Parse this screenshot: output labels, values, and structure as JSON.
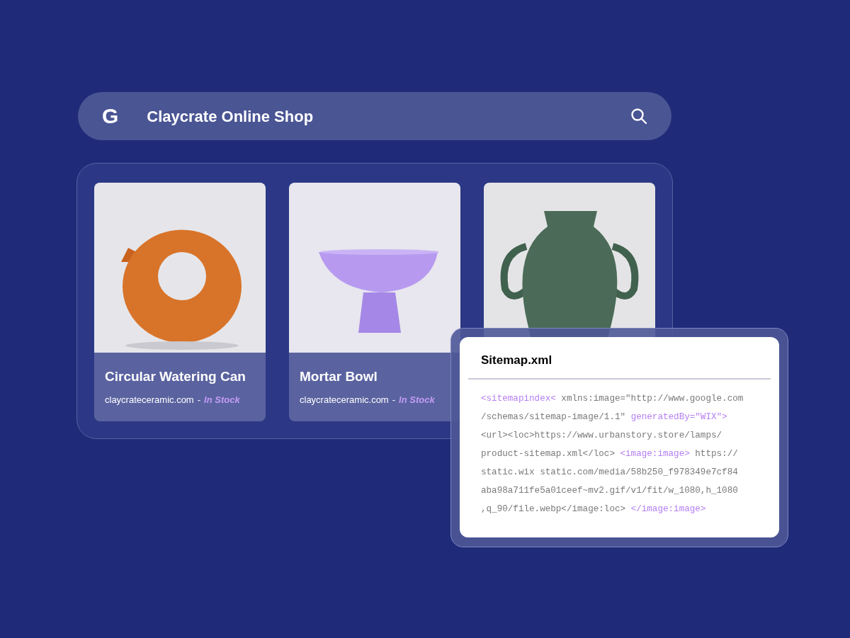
{
  "search_bar": {
    "logo": "G",
    "query": "Claycrate Online Shop"
  },
  "products": [
    {
      "kind": "listing",
      "photo": {
        "kind": "vase"
      },
      "name": "Circular Watering Can",
      "domain": "claycrateceramic.com",
      "separator": "-",
      "stock": "In Stock"
    },
    {
      "kind": "listing",
      "photo": {
        "kind": "bowl"
      },
      "name": "Mortar Bowl",
      "domain": "claycrateceramic.com",
      "separator": "-",
      "stock": "In Stock"
    },
    {
      "kind": "photo_only",
      "photo": {
        "kind": "urn"
      }
    }
  ],
  "sitemap": {
    "title": "Sitemap.xml",
    "lines": [
      [
        {
          "kind": "tag",
          "text": "<sitemapindex<"
        },
        {
          "kind": "text",
          "text": " xmlns:image=\"http://www.google.com"
        }
      ],
      [
        {
          "kind": "text",
          "text": "/schemas/sitemap-image/1.1\" "
        },
        {
          "kind": "tag",
          "text": "generatedBy=\"WIX\">"
        }
      ],
      [
        {
          "kind": "text",
          "text": "<url><loc>https://www.urbanstory.store/lamps/"
        }
      ],
      [
        {
          "kind": "text",
          "text": "product-sitemap.xml</loc> "
        },
        {
          "kind": "tag",
          "text": "<image:image>"
        },
        {
          "kind": "text",
          "text": " https://"
        }
      ],
      [
        {
          "kind": "text",
          "text": "static.wix static.com/media/58b250_f978349e7cf84"
        }
      ],
      [
        {
          "kind": "text",
          "text": "aba98a711fe5a01ceef~mv2.gif/v1/fit/w_1080,h_1080"
        }
      ],
      [
        {
          "kind": "text",
          "text": ",q_90/file.webp</image:loc> "
        },
        {
          "kind": "tag",
          "text": "</image:image>"
        }
      ]
    ]
  }
}
